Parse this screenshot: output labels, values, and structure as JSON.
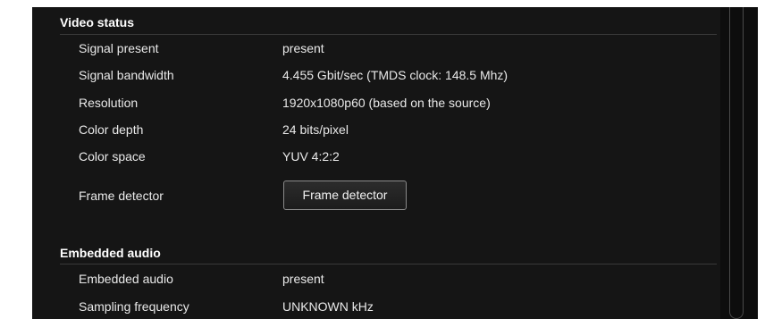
{
  "video_status": {
    "title": "Video status",
    "rows": [
      {
        "label": "Signal present",
        "value": "present"
      },
      {
        "label": "Signal bandwidth",
        "value": "4.455 Gbit/sec (TMDS clock: 148.5 Mhz)"
      },
      {
        "label": "Resolution",
        "value": "1920x1080p60 (based on the source)"
      },
      {
        "label": "Color depth",
        "value": "24 bits/pixel"
      },
      {
        "label": "Color space",
        "value": "YUV 4:2:2"
      }
    ],
    "frame_detector": {
      "label": "Frame detector",
      "button_label": "Frame detector"
    }
  },
  "embedded_audio": {
    "title": "Embedded audio",
    "rows": [
      {
        "label": "Embedded audio",
        "value": "present"
      },
      {
        "label": "Sampling frequency",
        "value": "UNKNOWN kHz"
      }
    ]
  },
  "colors": {
    "panel_background": "#151515",
    "text": "#e9e9e9",
    "heading": "#ffffff",
    "divider": "#3a3a3a"
  }
}
